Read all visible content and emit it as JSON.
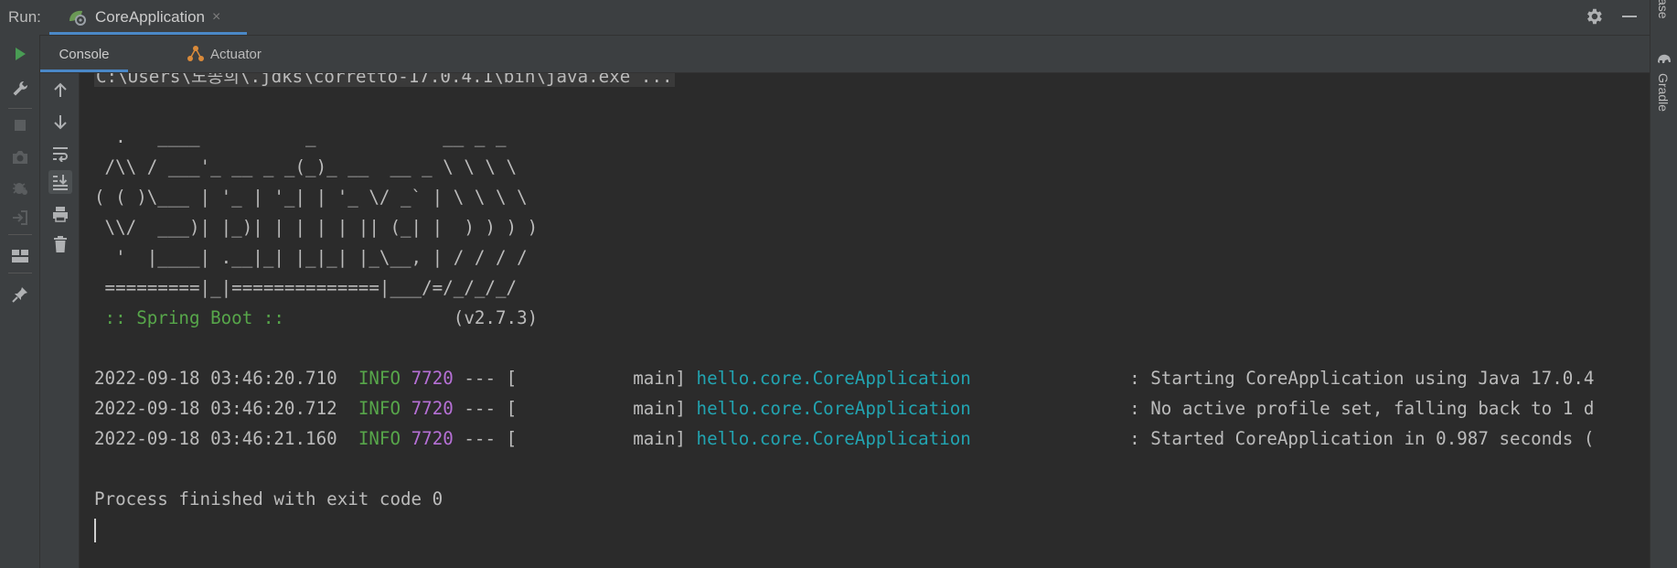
{
  "run_bar": {
    "label": "Run:",
    "tab_title": "CoreApplication",
    "close_glyph": "×",
    "icons": [
      "spring-boot-run-icon",
      "close-icon",
      "gear-icon",
      "minimize-icon"
    ]
  },
  "right_strip": {
    "items": [
      "ase",
      "Gradle"
    ],
    "icons": [
      "gradle-elephant-icon"
    ]
  },
  "left_toolbar": {
    "icons": [
      "rerun-icon",
      "wrench-icon",
      "stop-icon",
      "camera-icon",
      "bug-settings-icon",
      "exit-icon",
      "layout-icon",
      "pin-icon"
    ],
    "accent": "#499c54"
  },
  "tool_tabs": {
    "console": "Console",
    "actuator": "Actuator",
    "icons": [
      "actuator-icon"
    ]
  },
  "console_toolbar": {
    "icons": [
      "up-arrow-icon",
      "down-arrow-icon",
      "soft-wrap-icon",
      "scroll-to-end-icon",
      "print-icon",
      "trash-icon"
    ]
  },
  "console": {
    "command_line": "C:\\Users\\노송희\\.jdks\\corretto-17.0.4.1\\bin\\java.exe ...",
    "banner": [
      "  .   ____          _            __ _ _",
      " /\\\\ / ___'_ __ _ _(_)_ __  __ _ \\ \\ \\ \\",
      "( ( )\\___ | '_ | '_| | '_ \\/ _` | \\ \\ \\ \\",
      " \\\\/  ___)| |_)| | | | | || (_| |  ) ) ) )",
      "  '  |____| .__|_| |_|_| |_\\__, | / / / /",
      " =========|_|==============|___/=/_/_/_/"
    ],
    "spring_boot_label": " :: Spring Boot :: ",
    "spring_boot_version": "               (v2.7.3)",
    "logs": [
      {
        "timestamp": "2022-09-18 03:46:20.710",
        "level": "INFO",
        "pid": "7720",
        "sep": " --- [           main] ",
        "logger": "hello.core.CoreApplication",
        "message": "               : Starting CoreApplication using Java 17.0.4"
      },
      {
        "timestamp": "2022-09-18 03:46:20.712",
        "level": "INFO",
        "pid": "7720",
        "sep": " --- [           main] ",
        "logger": "hello.core.CoreApplication",
        "message": "               : No active profile set, falling back to 1 d"
      },
      {
        "timestamp": "2022-09-18 03:46:21.160",
        "level": "INFO",
        "pid": "7720",
        "sep": " --- [           main] ",
        "logger": "hello.core.CoreApplication",
        "message": "               : Started CoreApplication in 0.987 seconds ("
      }
    ],
    "process_finished": "Process finished with exit code 0",
    "colors": {
      "info": "#57a64a",
      "pid": "#b670d6",
      "logger": "#22a4b1",
      "text": "#bbbbbb"
    }
  }
}
